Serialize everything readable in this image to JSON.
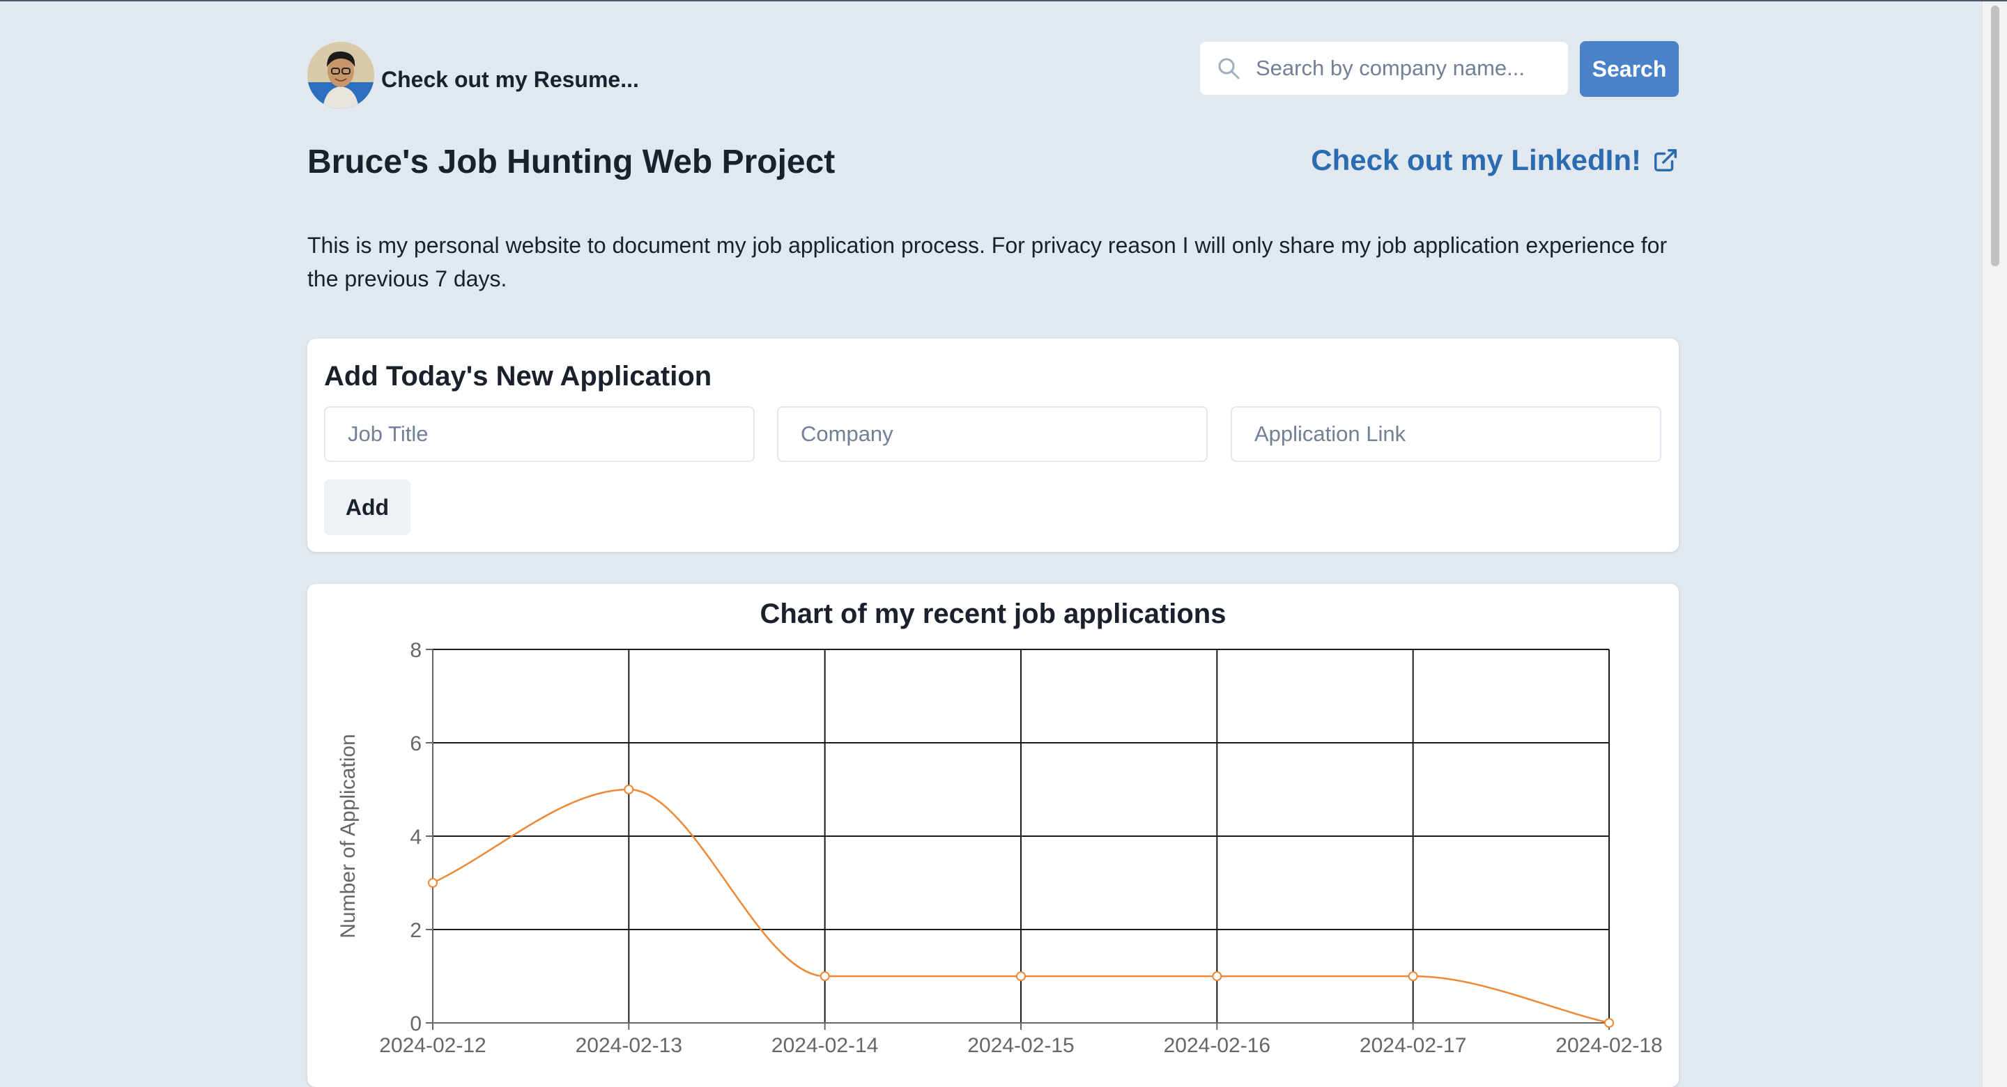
{
  "header": {
    "resume_link_text": "Check out my Resume...",
    "search_placeholder": "Search by company name...",
    "search_button_label": "Search",
    "page_title": "Bruce's Job Hunting Web Project",
    "linkedin_link_text": "Check out my LinkedIn!"
  },
  "intro": {
    "text": "This is my personal website to document my job application process. For privacy reason I will only share my job application experience for the previous 7 days."
  },
  "add_form": {
    "title": "Add Today's New Application",
    "job_title_placeholder": "Job Title",
    "company_placeholder": "Company",
    "link_placeholder": "Application Link",
    "add_button_label": "Add"
  },
  "colors": {
    "accent": "#4a82c9",
    "link": "#2b6cb0",
    "background": "#e2e8f0",
    "line_series": "#ed8936"
  },
  "icons": {
    "search": "search-icon",
    "external_link": "external-link-icon",
    "avatar": "avatar-photo"
  },
  "chart_data": {
    "type": "line",
    "title": "Chart of my recent job applications",
    "xlabel": "",
    "ylabel": "Number of Application",
    "categories": [
      "2024-02-12",
      "2024-02-13",
      "2024-02-14",
      "2024-02-15",
      "2024-02-16",
      "2024-02-17",
      "2024-02-18"
    ],
    "values": [
      3,
      5,
      1,
      1,
      1,
      1,
      0
    ],
    "ylim": [
      0,
      8
    ],
    "yticks": [
      0,
      2,
      4,
      6,
      8
    ],
    "grid": true,
    "smooth": true,
    "legend": "none"
  }
}
